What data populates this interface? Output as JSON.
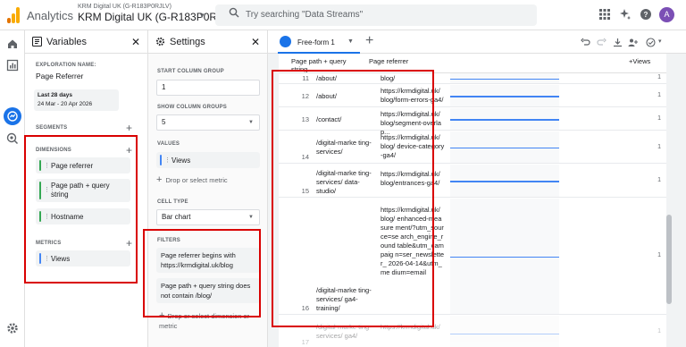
{
  "topbar": {
    "app_name": "Analytics",
    "account_small": "KRM Digital UK (G-R183P0RJLV)",
    "account_name": "KRM Digital UK (G-R183P0RJ...",
    "search_placeholder": "Try searching \"Data Streams\"",
    "avatar_initial": "A"
  },
  "variables": {
    "title": "Variables",
    "exploration_label": "EXPLORATION NAME:",
    "exploration_name": "Page Referrer",
    "date_label": "Last 28 days",
    "date_range": "24 Mar - 20 Apr 2026",
    "segments_label": "SEGMENTS",
    "dimensions_label": "DIMENSIONS",
    "dimensions": [
      "Page referrer",
      "Page path + query string",
      "Hostname"
    ],
    "metrics_label": "METRICS",
    "metrics": [
      "Views"
    ]
  },
  "settings": {
    "title": "Settings",
    "start_col_label": "START COLUMN GROUP",
    "start_col_value": "1",
    "show_col_label": "SHOW COLUMN GROUPS",
    "show_col_value": "5",
    "values_label": "VALUES",
    "value_chip": "Views",
    "drop_metric": "Drop or select metric",
    "cell_type_label": "CELL TYPE",
    "cell_type_value": "Bar chart",
    "filters_label": "FILTERS",
    "filters": [
      "Page referrer begins with https://krmdigital.uk/blog",
      "Page path + query string does not contain /blog/"
    ],
    "drop_dimension": "Drop or select dimension or metric"
  },
  "canvas": {
    "tab_label": "Free-form 1",
    "col_path": "Page path + query string",
    "col_ref": "Page referrer",
    "col_views": "+Views",
    "rows": [
      {
        "num": "11",
        "path": "/about/",
        "ref": "blog/",
        "val": "1"
      },
      {
        "num": "12",
        "path": "/about/",
        "ref": "https://krmdigital.uk/ blog/form-errors-ga4/",
        "val": "1"
      },
      {
        "num": "13",
        "path": "/contact/",
        "ref": "https://krmdigital.uk/ blog/segment-overlap...",
        "val": "1"
      },
      {
        "num": "14",
        "path": "/digital-marke ting-services/",
        "ref": "https://krmdigital.uk/ blog/ device-category-ga4/",
        "val": "1"
      },
      {
        "num": "15",
        "path": "/digital-marke ting-services/ data-studio/",
        "ref": "https://krmdigital.uk/ blog/entrances-ga4/",
        "val": "1"
      },
      {
        "num": "16",
        "path": "/digital-marke ting-services/ ga4-training/",
        "ref": "https://krmdigital.uk/ blog/ enhanced-measure ment/?utm_source=se arch_engine_round table&utm_campaig n=ser_newsletter_ 2026-04-14&utm_me dium=email",
        "val": "1"
      },
      {
        "num": "17",
        "path": "/digital-marke ting-services/ ga4/",
        "ref": "https://krmdigital.uk/",
        "val": "1"
      }
    ]
  },
  "colors": {
    "accent": "#1a73e8",
    "highlight": "#d90000",
    "chip_bar_dim": "#34a853",
    "chip_bar_metric": "#4285f4"
  }
}
